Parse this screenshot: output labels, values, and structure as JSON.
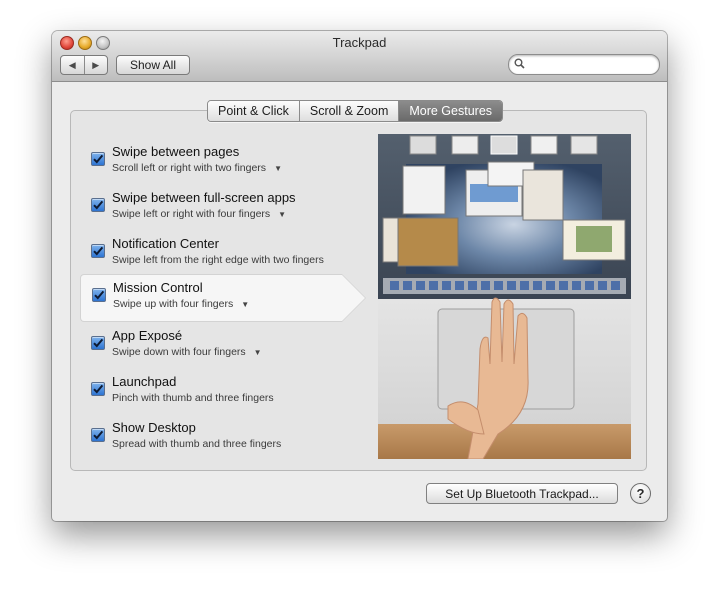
{
  "window": {
    "title": "Trackpad",
    "back_icon": "◀",
    "forward_icon": "▶",
    "show_all_label": "Show All",
    "search_placeholder": ""
  },
  "tabs": [
    {
      "label": "Point & Click",
      "active": false
    },
    {
      "label": "Scroll & Zoom",
      "active": false
    },
    {
      "label": "More Gestures",
      "active": true
    }
  ],
  "gestures": [
    {
      "title": "Swipe between pages",
      "subtitle": "Scroll left or right with two fingers",
      "checked": true,
      "has_menu": true,
      "selected": false
    },
    {
      "title": "Swipe between full-screen apps",
      "subtitle": "Swipe left or right with four fingers",
      "checked": true,
      "has_menu": true,
      "selected": false
    },
    {
      "title": "Notification Center",
      "subtitle": "Swipe left from the right edge with two fingers",
      "checked": true,
      "has_menu": false,
      "selected": false
    },
    {
      "title": "Mission Control",
      "subtitle": "Swipe up with four fingers",
      "checked": true,
      "has_menu": true,
      "selected": true
    },
    {
      "title": "App Exposé",
      "subtitle": "Swipe down with four fingers",
      "checked": true,
      "has_menu": true,
      "selected": false
    },
    {
      "title": "Launchpad",
      "subtitle": "Pinch with thumb and three fingers",
      "checked": true,
      "has_menu": false,
      "selected": false
    },
    {
      "title": "Show Desktop",
      "subtitle": "Spread with thumb and three fingers",
      "checked": true,
      "has_menu": false,
      "selected": false
    }
  ],
  "menu_arrow": "▼",
  "footer": {
    "bluetooth_button": "Set Up Bluetooth Trackpad...",
    "help_label": "?"
  },
  "colors": {
    "checkbox_blue": "#2d74d2",
    "active_tab": "#7a7a7a"
  }
}
